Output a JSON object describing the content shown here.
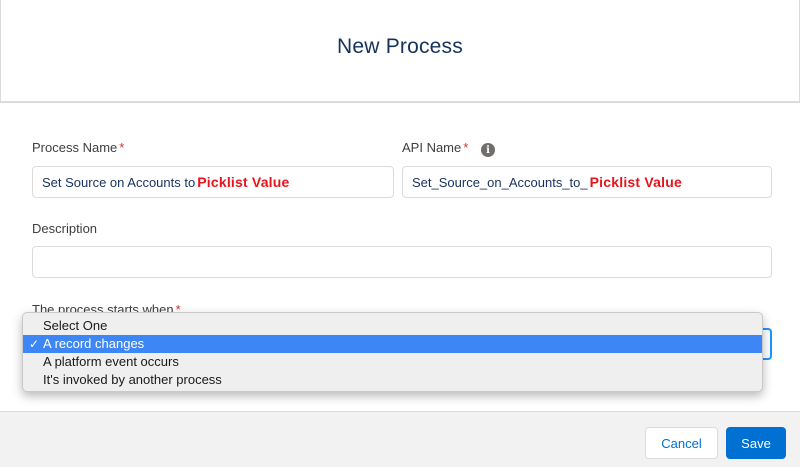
{
  "header": {
    "title": "New Process"
  },
  "form": {
    "process_name": {
      "label": "Process Name",
      "required_mark": "*",
      "value": "Set Source on Accounts to",
      "overlay": "Picklist Value"
    },
    "api_name": {
      "label": "API Name",
      "required_mark": "*",
      "info_icon": "i",
      "value": "Set_Source_on_Accounts_to_",
      "overlay": "Picklist Value"
    },
    "description": {
      "label": "Description",
      "value": ""
    },
    "start": {
      "label": "The process starts when",
      "required_mark": "*",
      "options": [
        {
          "label": "Select One",
          "selected": false
        },
        {
          "label": "A record changes",
          "selected": true
        },
        {
          "label": "A platform event occurs",
          "selected": false
        },
        {
          "label": "It's invoked by another process",
          "selected": false
        }
      ],
      "check_mark": "✓"
    }
  },
  "footer": {
    "cancel_label": "Cancel",
    "save_label": "Save"
  },
  "colors": {
    "brand": "#0070d2",
    "title": "#16325c",
    "required": "#c23934",
    "overlay_text": "#e8141b",
    "selected_option": "#3d86f5"
  }
}
